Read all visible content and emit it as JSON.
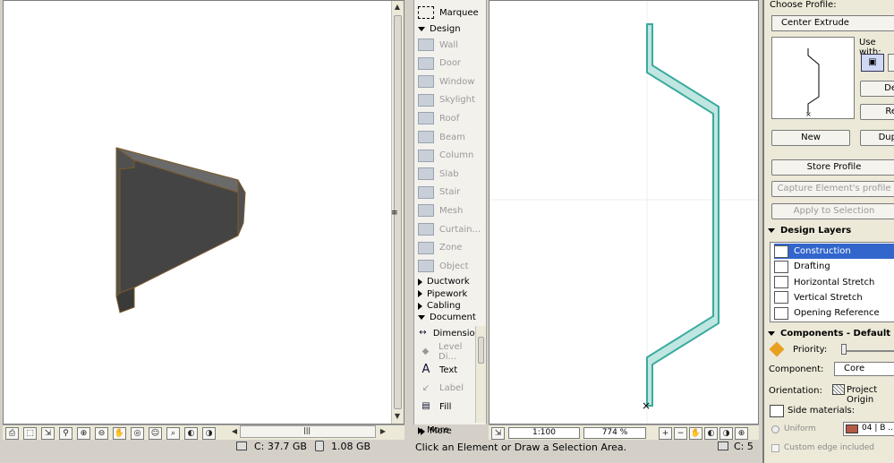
{
  "left_view": {
    "status": {
      "disk_c": "C: 37.7 GB",
      "disk_other": "1.08 GB"
    },
    "toolbar_icons": [
      "print-icon",
      "zoom-box-icon",
      "fit-icon",
      "zoom-icon",
      "zoom-in-icon",
      "zoom-out-icon",
      "pan-icon",
      "orbit-icon",
      "walk-icon",
      "magnify-icon",
      "zoom-prev-icon",
      "zoom-next-icon"
    ]
  },
  "toolbox": {
    "marquee": "Marquee",
    "design_group": "Design",
    "design_tools": [
      "Wall",
      "Door",
      "Window",
      "Skylight",
      "Roof",
      "Beam",
      "Column",
      "Slab",
      "Stair",
      "Mesh",
      "Curtain...",
      "Zone",
      "Object"
    ],
    "subgroups": [
      "Ductwork",
      "Pipework",
      "Cabling"
    ],
    "document_group": "Document",
    "document_tools": [
      {
        "label": "Dimension",
        "enabled": true
      },
      {
        "label": "Level Di...",
        "enabled": false
      },
      {
        "label": "Text",
        "enabled": true
      },
      {
        "label": "Label",
        "enabled": false
      },
      {
        "label": "Fill",
        "enabled": true
      }
    ],
    "more": "More"
  },
  "profile_editor": {
    "scale": "1:100",
    "zoom": "774 %",
    "hint": "Click an Element or Draw a Selection Area.",
    "disk_c": "C: 5"
  },
  "profile_palette": {
    "choose_profile_label": "Choose Profile:",
    "profile_selected": "Center Extrude",
    "use_with_label": "Use with:",
    "btn_delete": "De",
    "btn_rename": "Re",
    "btn_new": "New",
    "btn_duplicate": "Dup",
    "btn_store": "Store Profile",
    "btn_capture": "Capture Element's profile",
    "btn_apply": "Apply to Selection",
    "design_layers_title": "Design Layers",
    "layers": [
      "Construction",
      "Drafting",
      "Horizontal Stretch",
      "Vertical Stretch",
      "Opening Reference"
    ],
    "components_title": "Components - Default",
    "priority_label": "Priority:",
    "component_label": "Component:",
    "component_value": "Core",
    "orientation_label": "Orientation:",
    "orientation_value": "Project Origin",
    "side_materials_label": "Side materials:",
    "uniform_label": "Uniform",
    "material_value": "04 | B ...",
    "custom_edge_label": "Custom edge included",
    "colors": {
      "selection": "#3366cc",
      "material_swatch": "#b65a48",
      "profile_fill": "#bfe6e0",
      "profile_stroke": "#3aaa9f"
    }
  }
}
